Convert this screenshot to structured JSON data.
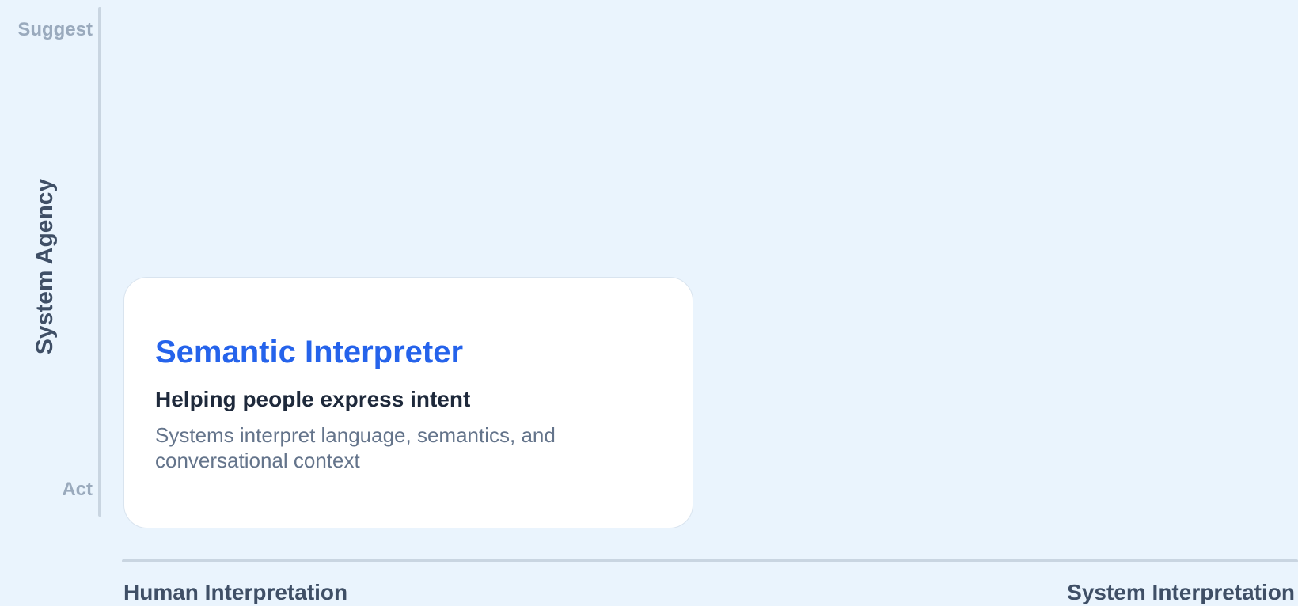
{
  "y_axis": {
    "title": "System Agency",
    "top_label": "Suggest",
    "bottom_label": "Act"
  },
  "x_axis": {
    "left_label": "Human Interpretation",
    "right_label": "System Interpretation"
  },
  "card": {
    "title": "Semantic Interpreter",
    "subtitle": "Helping people express intent",
    "description": "Systems interpret language, semantics, and conversational context"
  },
  "colors": {
    "background": "#eaf4fd",
    "card_title": "#2563eb",
    "axis_line": "#c9d5e1",
    "axis_title": "#3f4f66",
    "axis_end_label": "#9aaabd"
  }
}
